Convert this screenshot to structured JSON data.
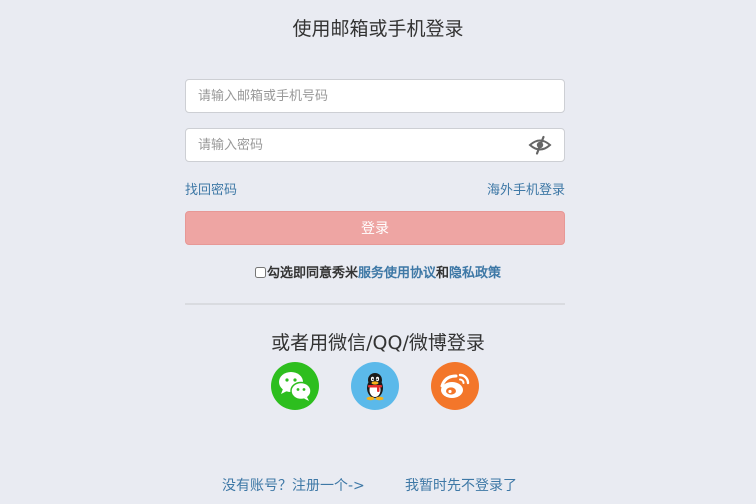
{
  "page": {
    "title": "使用邮箱或手机登录"
  },
  "form": {
    "email_placeholder": "请输入邮箱或手机号码",
    "password_placeholder": "请输入密码",
    "password_toggle_icon": "eye-slash-icon",
    "forgot_password": "找回密码",
    "overseas_login": "海外手机登录",
    "login_button": "登录",
    "login_button_color": "#eea5a3"
  },
  "agreement": {
    "checked": false,
    "prefix": "勾选即同意秀米",
    "terms_link": "服务使用协议",
    "and": "和",
    "privacy_link": "隐私政策"
  },
  "social": {
    "title": "或者用微信/QQ/微博登录",
    "items": [
      {
        "name": "wechat",
        "icon": "wechat-icon",
        "color": "#2dbe1e"
      },
      {
        "name": "qq",
        "icon": "qq-penguin-icon",
        "color": "#5bb9ea"
      },
      {
        "name": "weibo",
        "icon": "weibo-icon",
        "color": "#f3762a"
      }
    ]
  },
  "footer": {
    "register_link": "没有账号？注册一个->",
    "skip_link": "我暂时先不登录了"
  },
  "colors": {
    "background": "#e9ebf2",
    "link": "#3e78a6"
  }
}
